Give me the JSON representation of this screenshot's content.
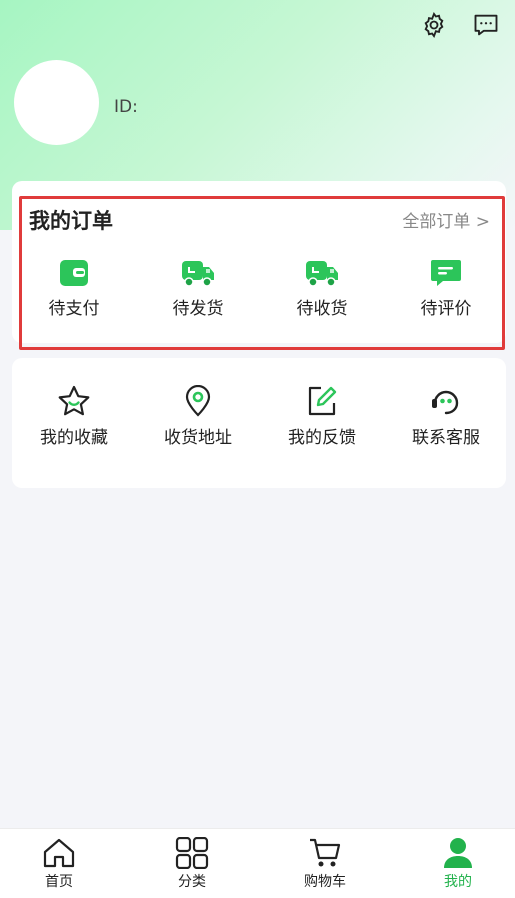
{
  "user": {
    "id_label": "ID:"
  },
  "orders": {
    "title": "我的订单",
    "all_link": "全部订单 >",
    "items": [
      {
        "label": "待支付",
        "icon": "wallet-icon"
      },
      {
        "label": "待发货",
        "icon": "truck-icon"
      },
      {
        "label": "待收货",
        "icon": "truck-icon"
      },
      {
        "label": "待评价",
        "icon": "comment-icon"
      }
    ]
  },
  "services": {
    "items": [
      {
        "label": "我的收藏",
        "icon": "star-icon"
      },
      {
        "label": "收货地址",
        "icon": "location-pin-icon"
      },
      {
        "label": "我的反馈",
        "icon": "edit-icon"
      },
      {
        "label": "联系客服",
        "icon": "headset-icon"
      }
    ]
  },
  "tabbar": {
    "items": [
      {
        "label": "首页",
        "icon": "home-icon"
      },
      {
        "label": "分类",
        "icon": "grid-icon"
      },
      {
        "label": "购物车",
        "icon": "cart-icon"
      },
      {
        "label": "我的",
        "icon": "person-icon",
        "active": true
      }
    ]
  },
  "colors": {
    "accent": "#22b24c",
    "highlight_border": "#e03b3b"
  }
}
